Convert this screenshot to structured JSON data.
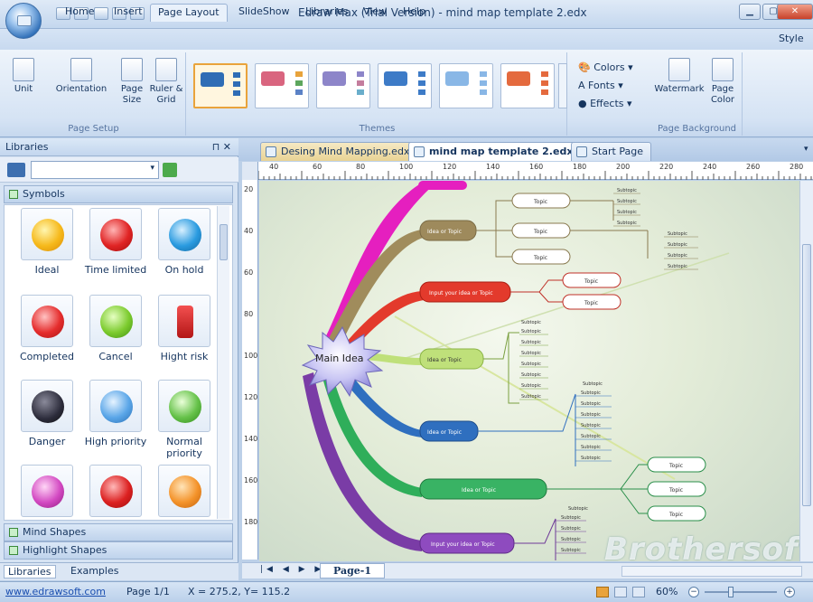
{
  "window": {
    "title": "Edraw Max (Trial Version) - mind map template 2.edx"
  },
  "ribbon_tabs": [
    "Home",
    "Insert",
    "Page Layout",
    "SlideShow",
    "Libraries",
    "View",
    "Help"
  ],
  "style_tab": "Style",
  "groups": {
    "page_setup": {
      "label": "Page Setup",
      "buttons": [
        "Unit",
        "Orientation",
        "Page Size",
        "Ruler & Grid"
      ]
    },
    "themes": {
      "label": "Themes"
    },
    "theme_options": [
      "Colors",
      "Fonts",
      "Effects"
    ],
    "page_background": {
      "label": "Page Background",
      "buttons": [
        "Watermark",
        "Page Color"
      ]
    }
  },
  "libraries": {
    "title": "Libraries",
    "pin": "⊓ ✕",
    "section_symbols": "Symbols",
    "symbols": [
      "Ideal",
      "Time limited",
      "On hold",
      "Completed",
      "Cancel",
      "Hight risk",
      "Danger",
      "High priority",
      "Normal priority"
    ],
    "section_mind": "Mind Shapes",
    "section_highlight": "Highlight Shapes",
    "bottom_tabs": [
      "Libraries",
      "Examples"
    ]
  },
  "doc_tabs": [
    "Desing Mind Mapping.edx",
    "mind map template 2.edx",
    "Start Page"
  ],
  "ruler_labels": [
    "40",
    "60",
    "80",
    "100",
    "120",
    "140",
    "160",
    "180",
    "200",
    "220",
    "240",
    "260",
    "280"
  ],
  "vruler_labels": [
    "20",
    "40",
    "60",
    "80",
    "100",
    "120",
    "140",
    "160",
    "180"
  ],
  "mindmap": {
    "center": "Main Idea",
    "branch_idea": "Idea or Topic",
    "branch_input": "Input your idea or Topic",
    "topic": "Topic",
    "subtopic": "Subtopic"
  },
  "page_tab": "Page-1",
  "status": {
    "url": "www.edrawsoft.com",
    "page": "Page 1/1",
    "coords": "X = 275.2, Y= 115.2",
    "zoom": "60%"
  },
  "watermark": "Brothersoft"
}
